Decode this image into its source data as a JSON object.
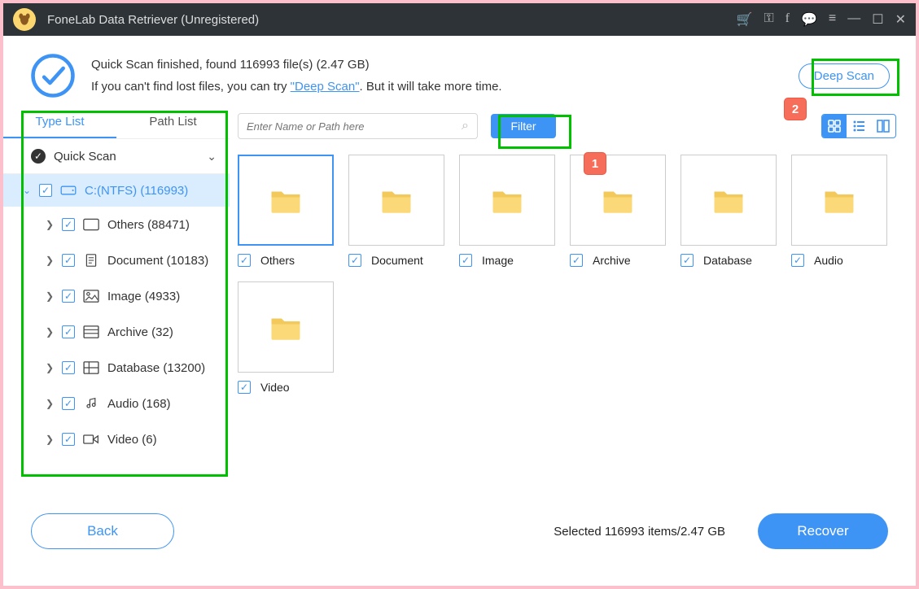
{
  "app": {
    "title": "FoneLab Data Retriever (Unregistered)"
  },
  "status": {
    "line1a": "Quick Scan finished, found ",
    "line1b": " file(s) (",
    "line1c": ")",
    "count": "116993",
    "size": "2.47 GB",
    "line2a": "If you can't find lost files, you can try ",
    "deep_link": "\"Deep Scan\"",
    "line2b": ". But it will take more time."
  },
  "buttons": {
    "deep_scan": "Deep Scan",
    "filter": "Filter",
    "back": "Back",
    "recover": "Recover"
  },
  "tabs": {
    "type_list": "Type List",
    "path_list": "Path List"
  },
  "search": {
    "placeholder": "Enter Name or Path here"
  },
  "tree": {
    "root": "Quick Scan",
    "drive": "C:(NTFS) (116993)",
    "nodes": [
      {
        "label": "Others (88471)"
      },
      {
        "label": "Document (10183)"
      },
      {
        "label": "Image (4933)"
      },
      {
        "label": "Archive (32)"
      },
      {
        "label": "Database (13200)"
      },
      {
        "label": "Audio (168)"
      },
      {
        "label": "Video (6)"
      }
    ]
  },
  "grid": {
    "items": [
      {
        "label": "Others",
        "selected": true
      },
      {
        "label": "Document",
        "selected": false
      },
      {
        "label": "Image",
        "selected": false
      },
      {
        "label": "Archive",
        "selected": false
      },
      {
        "label": "Database",
        "selected": false
      },
      {
        "label": "Audio",
        "selected": false
      },
      {
        "label": "Video",
        "selected": false
      }
    ]
  },
  "footer": {
    "summary": "Selected 116993 items/2.47 GB"
  },
  "annotations": {
    "one": "1",
    "two": "2"
  }
}
